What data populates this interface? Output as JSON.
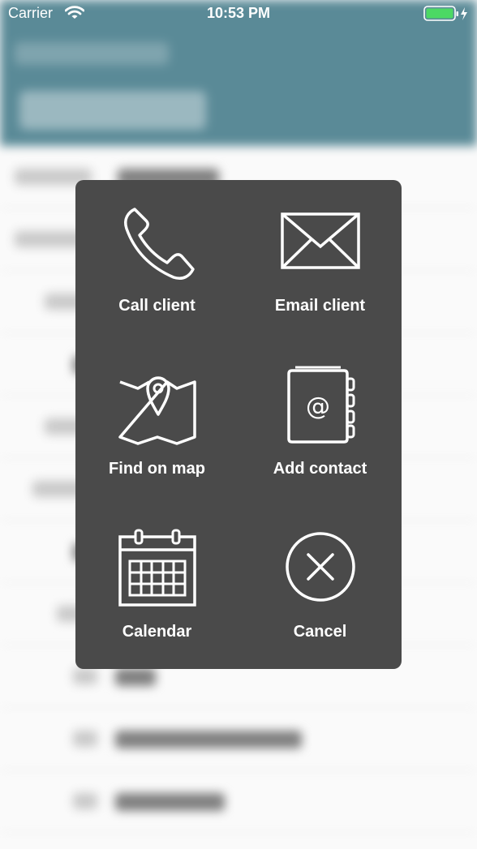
{
  "status_bar": {
    "carrier": "Carrier",
    "time": "10:53 PM",
    "battery_color": "#4cd964"
  },
  "theme": {
    "panel_bg": "#4a4a4a",
    "nav_bg": "#5a8a97"
  },
  "action_sheet": {
    "actions": [
      {
        "label": "Call client",
        "icon": "phone-icon"
      },
      {
        "label": "Email client",
        "icon": "envelope-icon"
      },
      {
        "label": "Find on map",
        "icon": "map-pin-icon"
      },
      {
        "label": "Add contact",
        "icon": "address-book-icon"
      },
      {
        "label": "Calendar",
        "icon": "calendar-icon"
      },
      {
        "label": "Cancel",
        "icon": "close-circle-icon"
      }
    ]
  }
}
